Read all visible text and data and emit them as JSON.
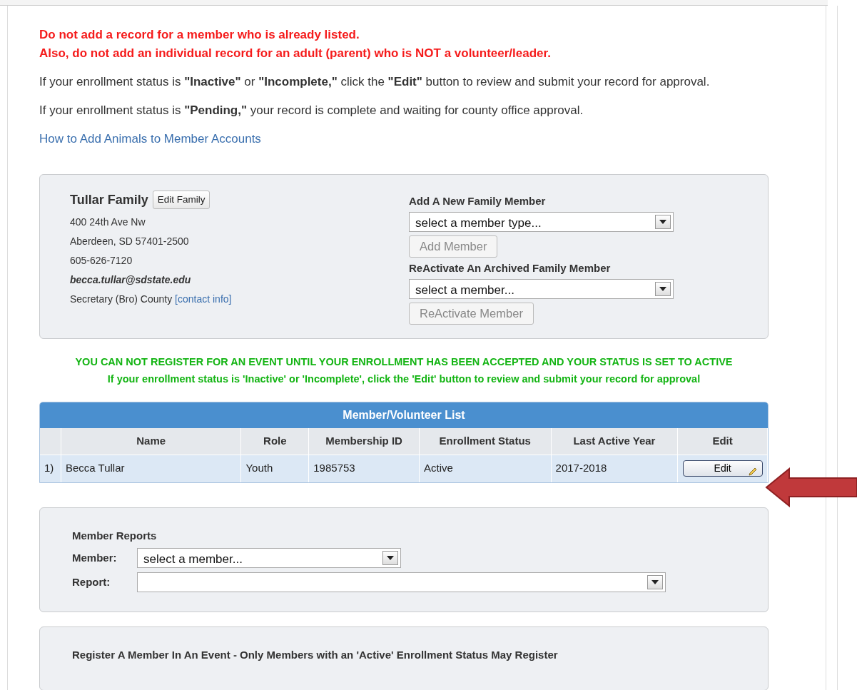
{
  "warnings": [
    "Do not add a record for a member who is already listed.",
    "Also, do not add an individual record for an adult (parent) who is NOT a volunteer/leader."
  ],
  "notes": [
    "If your enrollment status is **\"Inactive\"** or **\"Incomplete,\"** click the **\"Edit\"** button to review and submit your record for approval.",
    "If your enrollment status is **\"Pending,\"** your record is complete and waiting for county office approval."
  ],
  "help_link": "How to Add Animals to Member Accounts",
  "family": {
    "name": "Tullar Family",
    "edit_button": "Edit Family",
    "address": [
      "400 24th Ave Nw",
      "Aberdeen, SD 57401-2500",
      "605-626-7120"
    ],
    "email": "becca.tullar@sdstate.edu",
    "role": "Secretary (Bro) County",
    "contact_link": "[contact info]"
  },
  "add_member": {
    "label": "Add A New Family Member",
    "select": {
      "value": "select a member type..."
    },
    "button": {
      "label": "Add Member",
      "disabled": true
    }
  },
  "reactivate": {
    "label": "ReActivate An Archived Family Member",
    "select": {
      "value": "select a member..."
    },
    "button": {
      "label": "ReActivate Member",
      "disabled": true
    }
  },
  "notices": [
    "YOU CAN NOT REGISTER FOR AN EVENT UNTIL YOUR ENROLLMENT HAS BEEN ACCEPTED AND YOUR STATUS IS SET TO ACTIVE",
    "If your enrollment status is 'Inactive' or 'Incomplete', click the 'Edit' button to review and submit your record for approval"
  ],
  "table": {
    "title": "Member/Volunteer List",
    "columns": [
      "Name",
      "Role",
      "Membership ID",
      "Enrollment Status",
      "Last Active Year",
      "Edit"
    ],
    "rows": [
      {
        "index": "1)",
        "name": "Becca Tullar",
        "role": "Youth",
        "membership_id": "1985753",
        "status": "Active",
        "year": "2017-2018",
        "edit": "Edit"
      }
    ]
  },
  "reports": {
    "title": "Member Reports",
    "fields": [
      {
        "label": "Member:",
        "value": "select a member..."
      },
      {
        "label": "Report:"
      }
    ]
  },
  "register": {
    "title": "Register A Member In An Event - Only Members with an 'Active' Enrollment Status May Register"
  }
}
